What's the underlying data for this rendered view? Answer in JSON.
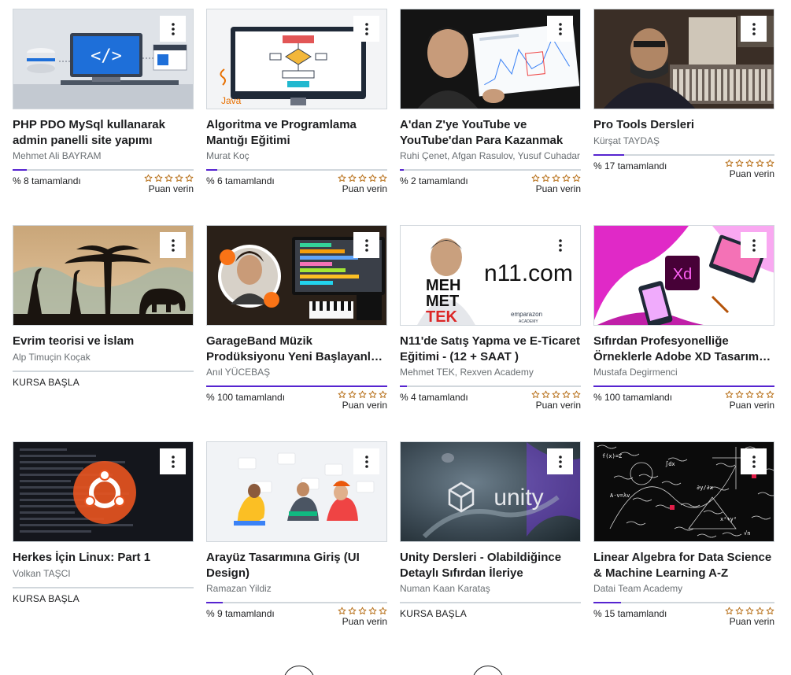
{
  "courses": [
    {
      "title": "PHP PDO MySql kullanarak admin panelli site yapımı",
      "instructor": "Mehmet Ali BAYRAM",
      "state": "progress",
      "progress_value": 8,
      "progress_text": "% 8 tamamlandı",
      "rate_label": "Puan verin",
      "thumb": "php"
    },
    {
      "title": "Algoritma ve Programlama Mantığı Eğitimi",
      "instructor": "Murat Koç",
      "state": "progress",
      "progress_value": 6,
      "progress_text": "% 6 tamamlandı",
      "rate_label": "Puan verin",
      "thumb": "algo"
    },
    {
      "title": "A'dan Z'ye YouTube ve YouTube'dan Para Kazanmak",
      "instructor": "Ruhi Çenet, Afgan Rasulov, Yusuf Cuhadar",
      "state": "progress",
      "progress_value": 2,
      "progress_text": "% 2 tamamlandı",
      "rate_label": "Puan verin",
      "thumb": "youtube"
    },
    {
      "title": "Pro Tools Dersleri",
      "instructor": "Kürşat TAYDAŞ",
      "state": "progress",
      "progress_value": 17,
      "progress_text": "% 17 tamamlandı",
      "rate_label": "Puan verin",
      "thumb": "protools"
    },
    {
      "title": "Evrim teorisi ve İslam",
      "instructor": "Alp Timuçin Koçak",
      "state": "start",
      "start_label": "KURSA BAŞLA",
      "thumb": "evrim"
    },
    {
      "title": "GarageBand Müzik Prodüksiyonu Yeni Başlayanlar İçin",
      "instructor": "Anıl YÜCEBAŞ",
      "state": "progress",
      "progress_value": 100,
      "progress_text": "% 100 tamamlandı",
      "rate_label": "Puan verin",
      "thumb": "garageband"
    },
    {
      "title": "N11'de Satış Yapma ve E-Ticaret Eğitimi - (12 + SAAT )",
      "instructor": "Mehmet TEK, Rexven Academy",
      "state": "progress",
      "progress_value": 4,
      "progress_text": "% 4 tamamlandı",
      "rate_label": "Puan verin",
      "thumb": "n11"
    },
    {
      "title": "Sıfırdan Profesyonelliğe Örneklerle Adobe XD Tasarım Eğitimi",
      "instructor": "Mustafa Degirmenci",
      "state": "progress",
      "progress_value": 100,
      "progress_text": "% 100 tamamlandı",
      "rate_label": "Puan verin",
      "thumb": "xd"
    },
    {
      "title": "Herkes İçin Linux: Part 1",
      "instructor": "Volkan TAŞCI",
      "state": "start",
      "start_label": "KURSA BAŞLA",
      "thumb": "linux"
    },
    {
      "title": "Arayüz Tasarımına Giriş (UI Design)",
      "instructor": "Ramazan Yildiz",
      "state": "progress",
      "progress_value": 9,
      "progress_text": "% 9 tamamlandı",
      "rate_label": "Puan verin",
      "thumb": "ui"
    },
    {
      "title": "Unity Dersleri - Olabildiğince Detaylı Sıfırdan İleriye",
      "instructor": "Numan Kaan Karataş",
      "state": "start",
      "start_label": "KURSA BAŞLA",
      "thumb": "unity"
    },
    {
      "title": "Linear Algebra for Data Science & Machine Learning A-Z",
      "instructor": "Datai Team Academy",
      "state": "progress",
      "progress_value": 15,
      "progress_text": "% 15 tamamlandı",
      "rate_label": "Puan verin",
      "thumb": "linalg"
    }
  ],
  "thumb_text": {
    "java": "Java",
    "n11_brand": "n11.com",
    "mehmet_tek": [
      "MEH",
      "MET",
      "TEK"
    ],
    "emparazon": [
      "emparazon",
      "ACADEMY"
    ],
    "xd": "Xd",
    "unity": "unity"
  },
  "colors": {
    "progress": "#5624d0",
    "track": "#d1d7dc",
    "star": "#b4690e"
  },
  "icons": {
    "card_menu": "kebab-menu-icon",
    "rating": "star-outline-icon",
    "pager": "pagination-button"
  }
}
